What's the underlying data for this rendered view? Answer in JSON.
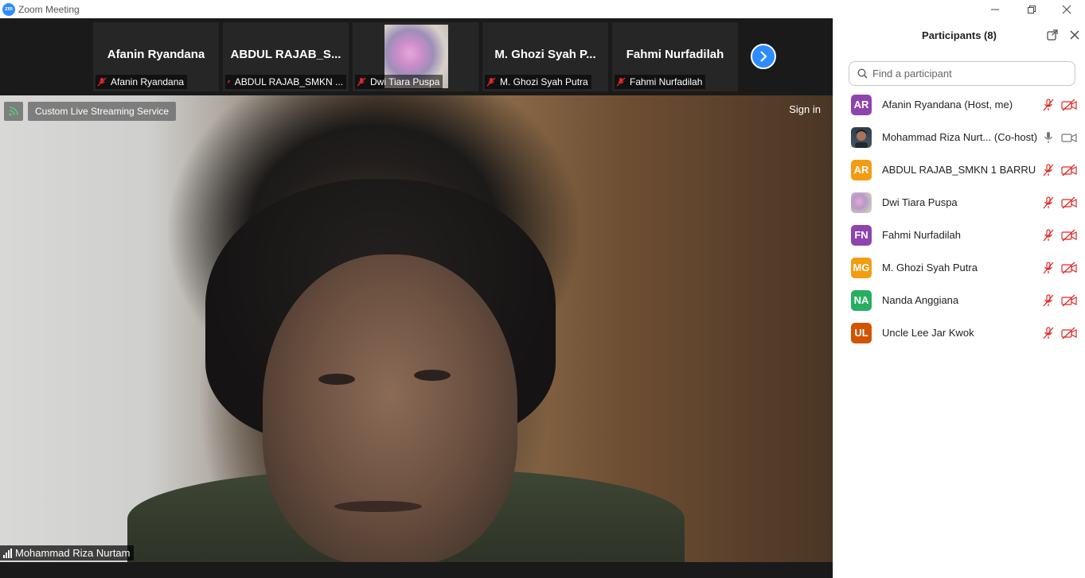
{
  "window": {
    "title": "Zoom Meeting",
    "logo_text": "zm",
    "controls": [
      "minimize",
      "restore",
      "close"
    ]
  },
  "thumbnails": [
    {
      "display_name": "Afanin Ryandana",
      "label": "Afanin Ryandana",
      "muted": true,
      "has_video": false
    },
    {
      "display_name": "ABDUL RAJAB_S...",
      "label": "ABDUL RAJAB_SMKN ...",
      "muted": true,
      "has_video": false
    },
    {
      "display_name": "",
      "label": "Dwi Tiara Puspa",
      "muted": true,
      "has_video": true
    },
    {
      "display_name": "M. Ghozi Syah P...",
      "label": "M. Ghozi Syah Putra",
      "muted": true,
      "has_video": false
    },
    {
      "display_name": "Fahmi Nurfadilah",
      "label": "Fahmi Nurfadilah",
      "muted": true,
      "has_video": false
    }
  ],
  "main_video": {
    "streaming_label": "Custom Live Streaming Service",
    "sign_in": "Sign in",
    "speaker_name": "Mohammad Riza Nurtam"
  },
  "participants_panel": {
    "title": "Participants (8)",
    "search_placeholder": "Find a participant",
    "participants": [
      {
        "initials": "AR",
        "name": "Afanin Ryandana (Host, me)",
        "color": "#8e44ad",
        "mic": "muted",
        "video": "off"
      },
      {
        "initials": "",
        "name": "Mohammad Riza Nurt...  (Co-host)",
        "color": "#3a3a3a",
        "mic": "on",
        "video": "on",
        "photo": true
      },
      {
        "initials": "AR",
        "name": "ABDUL RAJAB_SMKN 1 BARRU",
        "color": "#f39c12",
        "mic": "muted",
        "video": "off"
      },
      {
        "initials": "",
        "name": "Dwi Tiara Puspa",
        "color": "#b89bb6",
        "mic": "muted",
        "video": "off",
        "photo": true
      },
      {
        "initials": "FN",
        "name": "Fahmi Nurfadilah",
        "color": "#8e44ad",
        "mic": "muted",
        "video": "off"
      },
      {
        "initials": "MG",
        "name": "M. Ghozi Syah Putra",
        "color": "#f39c12",
        "mic": "muted",
        "video": "off"
      },
      {
        "initials": "NA",
        "name": "Nanda  Anggiana",
        "color": "#27ae60",
        "mic": "muted",
        "video": "off"
      },
      {
        "initials": "UL",
        "name": "Uncle Lee Jar Kwok",
        "color": "#d35400",
        "mic": "muted",
        "video": "off"
      }
    ]
  }
}
